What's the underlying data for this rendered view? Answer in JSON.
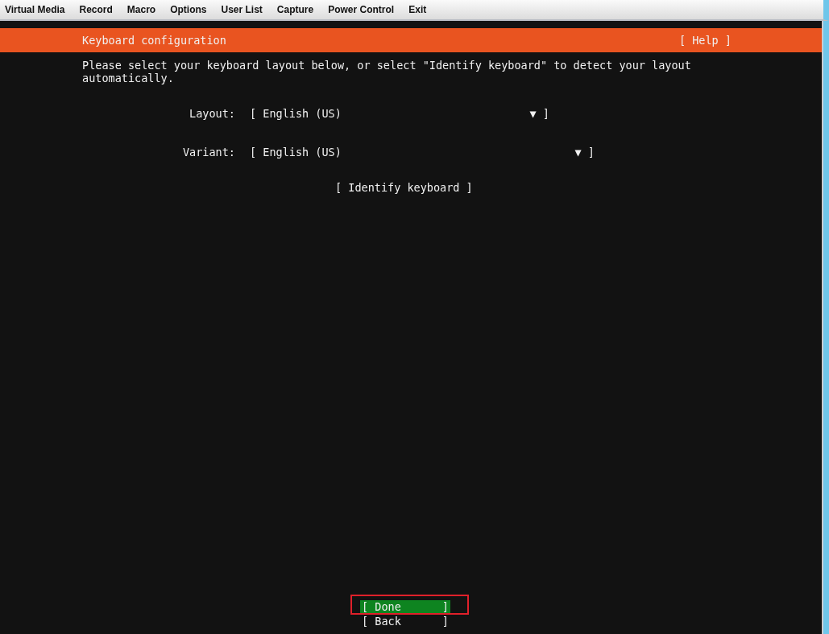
{
  "menu_bar": [
    "Virtual Media",
    "Record",
    "Macro",
    "Options",
    "User List",
    "Capture",
    "Power Control",
    "Exit"
  ],
  "header": {
    "title": "Keyboard configuration",
    "help": "[ Help ]"
  },
  "intro": "Please select your keyboard layout below, or select \"Identify keyboard\" to detect your layout automatically.",
  "fields": [
    {
      "label": "Layout:",
      "value": "[ English (US)",
      "arrow": "▼ ]",
      "kind": "short"
    },
    {
      "label": "Variant:",
      "value": "[ English (US)",
      "arrow": "▼ ]",
      "kind": "long"
    }
  ],
  "identify_button": "[ Identify keyboard ]",
  "buttons": [
    {
      "label": "[ Done",
      "close": "]",
      "selected": true,
      "highlighted": true
    },
    {
      "label": "[ Back",
      "close": "]",
      "selected": false,
      "highlighted": false
    }
  ]
}
